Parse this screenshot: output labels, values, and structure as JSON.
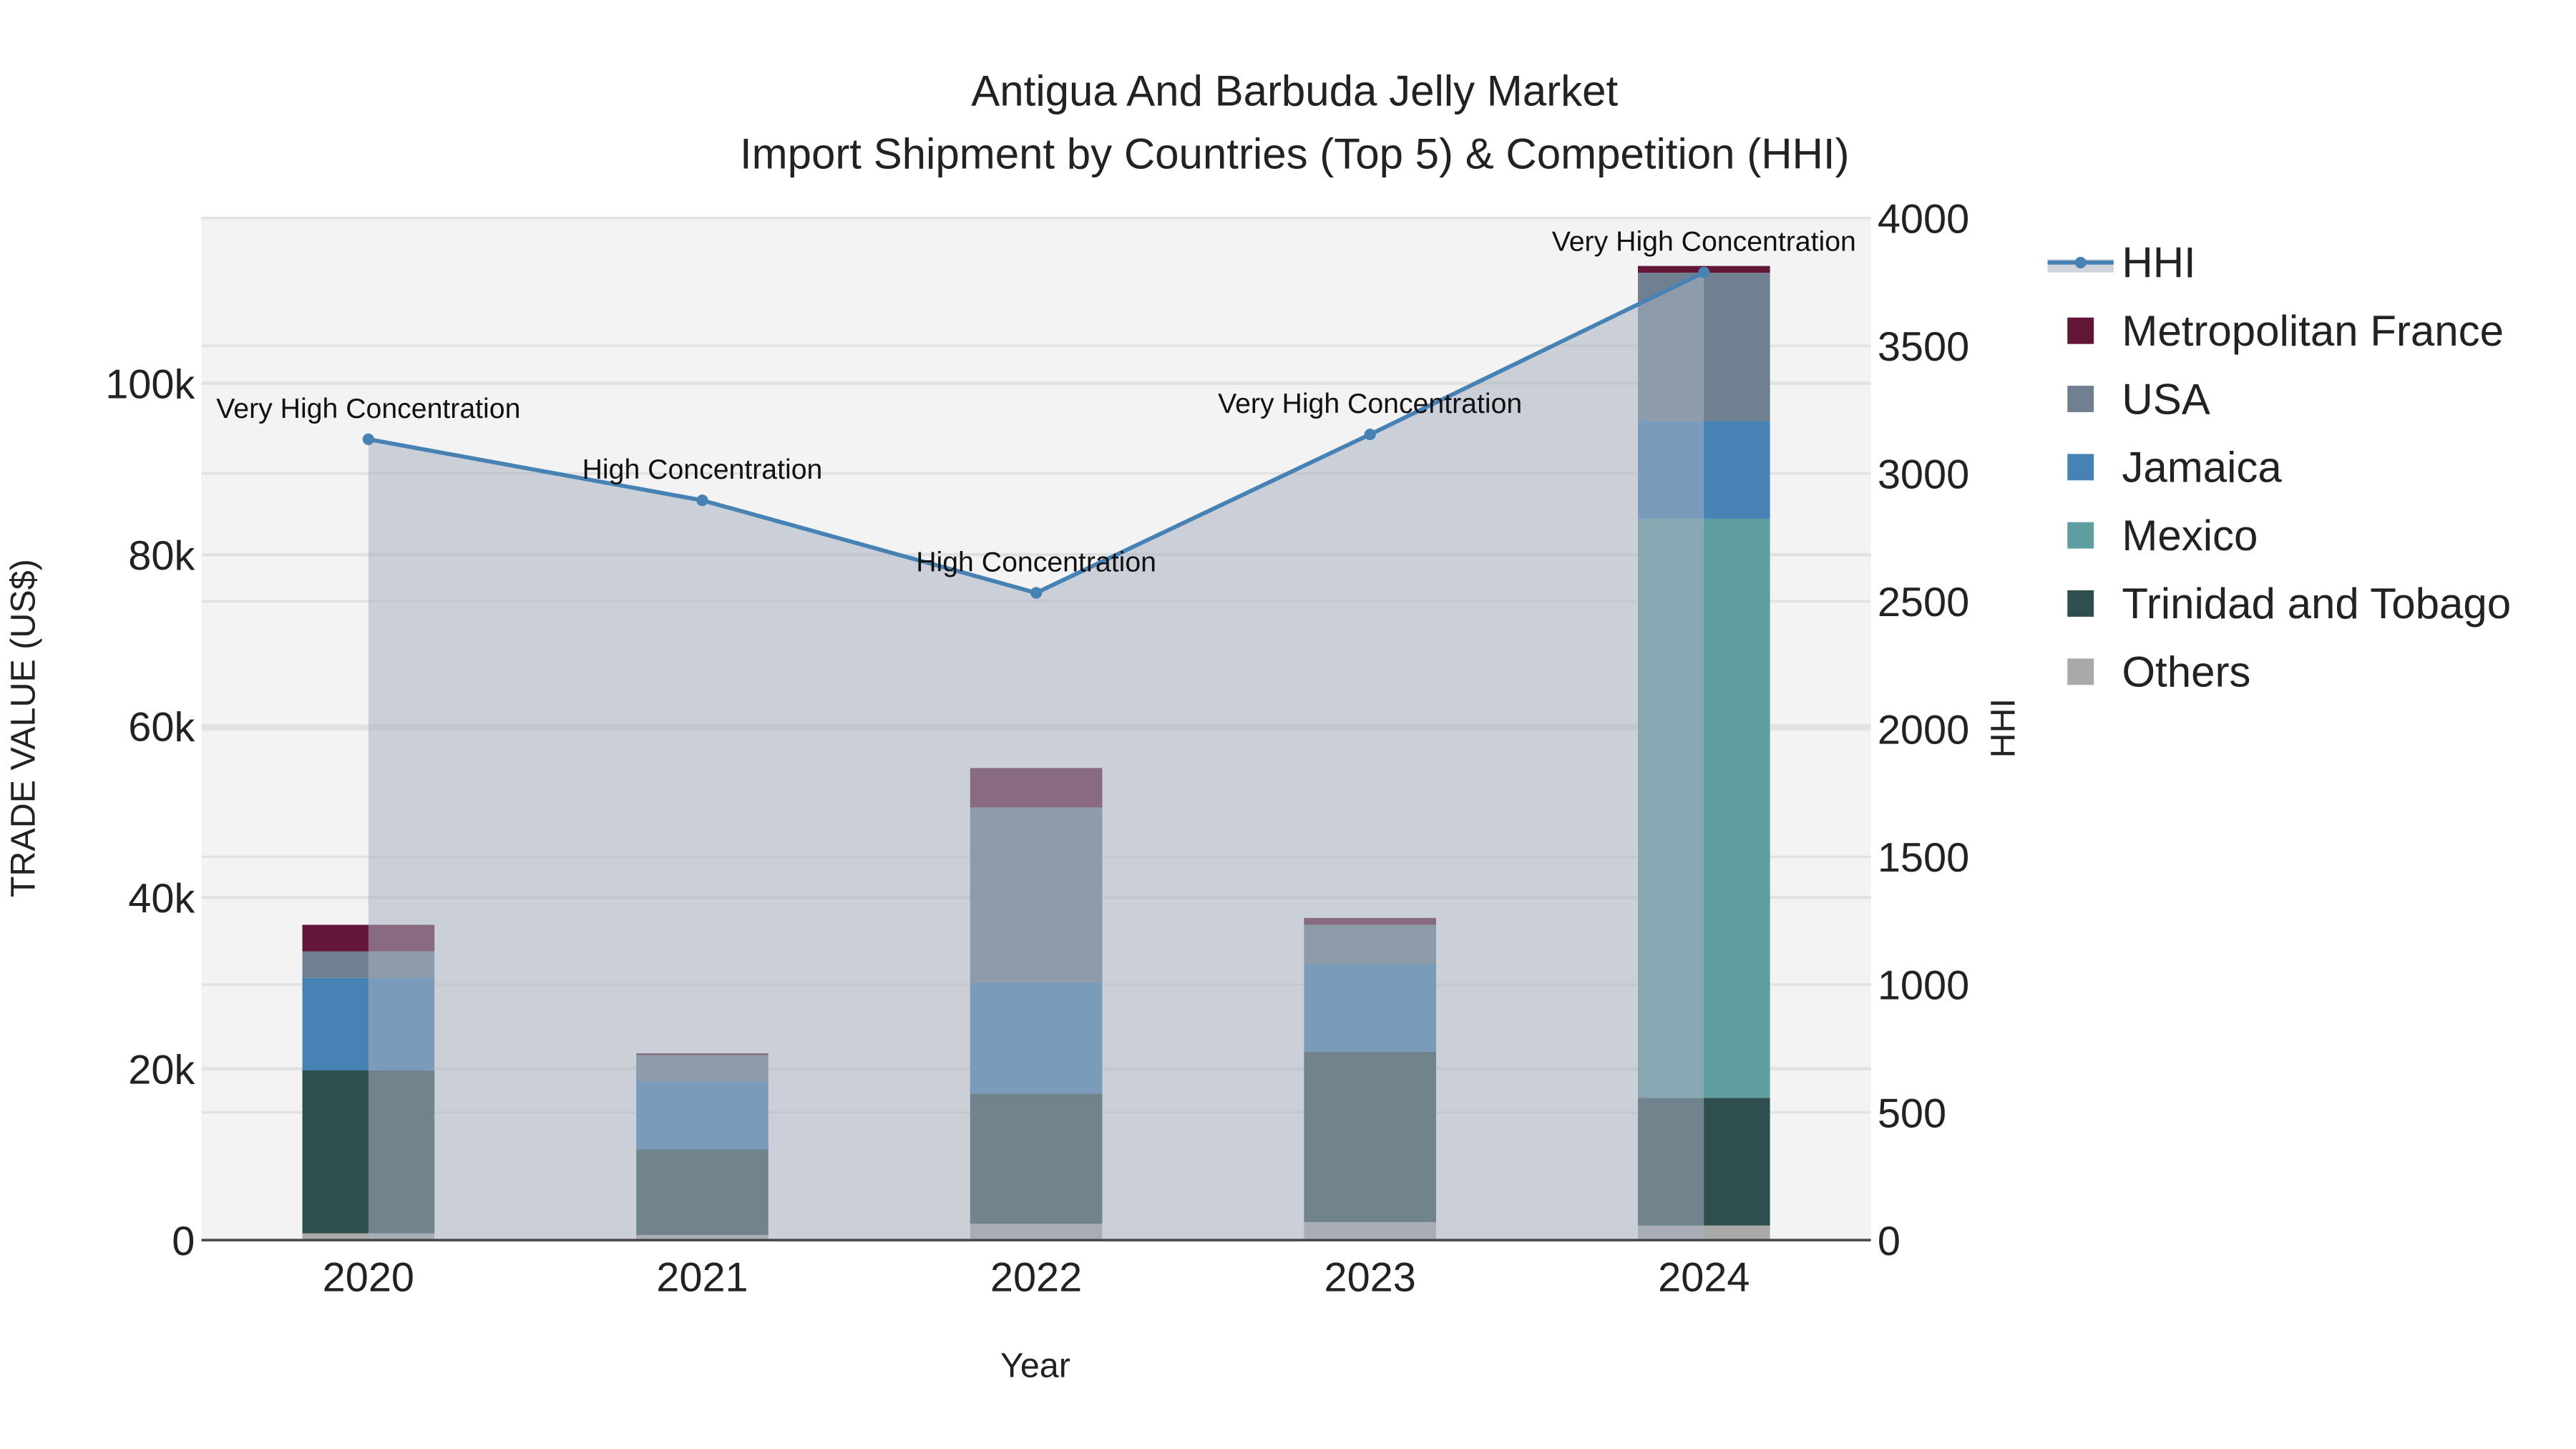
{
  "chart_data": {
    "type": "bar",
    "title": "Antigua And Barbuda Jelly Market",
    "subtitle": "Import Shipment by Countries (Top 5) & Competition (HHI)",
    "xlabel": "Year",
    "ylabel": "TRADE VALUE (US$)",
    "y2label": "HHI",
    "categories": [
      "2020",
      "2021",
      "2022",
      "2023",
      "2024"
    ],
    "ylim": [
      0,
      119300
    ],
    "y2lim": [
      0,
      4000
    ],
    "yticks": [
      0,
      20000,
      40000,
      60000,
      80000,
      100000
    ],
    "ytick_labels": [
      "0",
      "20k",
      "40k",
      "60k",
      "80k",
      "100k"
    ],
    "y2ticks": [
      0,
      500,
      1000,
      1500,
      2000,
      2500,
      3000,
      3500,
      4000
    ],
    "y2tick_labels": [
      "0",
      "500",
      "1000",
      "1500",
      "2000",
      "2500",
      "3000",
      "3500",
      "4000"
    ],
    "series": [
      {
        "name": "Others",
        "color": "#a9a9a9",
        "values": [
          800,
          600,
          1900,
          2100,
          1700
        ]
      },
      {
        "name": "Trinidad and Tobago",
        "color": "#2f4f4f",
        "values": [
          19000,
          10000,
          15200,
          19900,
          14900
        ]
      },
      {
        "name": "Mexico",
        "color": "#5f9ea0",
        "values": [
          0,
          0,
          0,
          0,
          67600
        ]
      },
      {
        "name": "Jamaica",
        "color": "#4682b4",
        "values": [
          10800,
          7900,
          13000,
          10200,
          11400
        ]
      },
      {
        "name": "USA",
        "color": "#708090",
        "values": [
          3100,
          3100,
          20400,
          4600,
          17300
        ]
      },
      {
        "name": "Metropolitan France",
        "color": "#641638",
        "values": [
          3100,
          200,
          4600,
          800,
          800
        ]
      }
    ],
    "hhi": {
      "name": "HHI",
      "color": "#4682b4",
      "values": [
        3134,
        2895,
        2533,
        3153,
        3787
      ]
    },
    "annotations": [
      "Very High Concentration",
      "High Concentration",
      "High Concentration",
      "Very High Concentration",
      "Very High Concentration"
    ],
    "legend_order": [
      "HHI",
      "Metropolitan France",
      "USA",
      "Jamaica",
      "Mexico",
      "Trinidad and Tobago",
      "Others"
    ],
    "legend_position": "right",
    "grid": true
  }
}
